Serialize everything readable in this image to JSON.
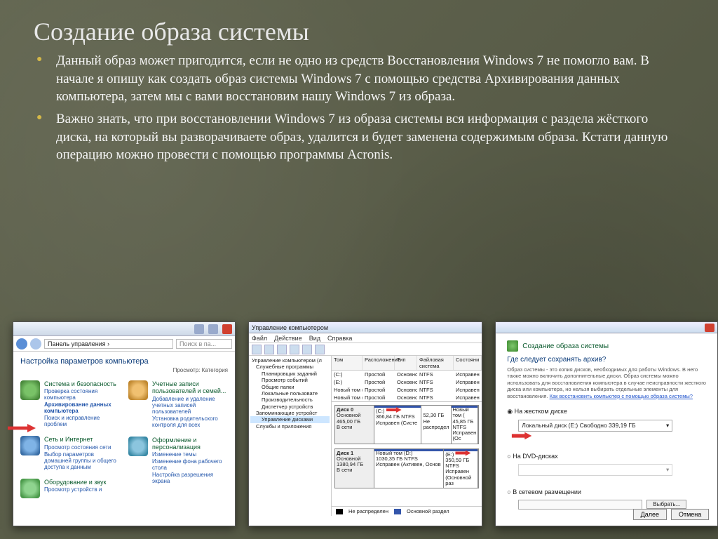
{
  "slide": {
    "title": "Создание образа системы",
    "bullet1": "Данный образ может пригодится, если не одно из средств Восстановления Windows 7 не помогло вам. В начале я опишу как создать образ системы Windows 7 с помощью средства Архивирования данных компьютера, затем мы с вами восстановим нашу Windows 7 из образа.",
    "bullet2": "Важно знать, что при восстановлении Windows 7 из образа системы вся информация с раздела жёсткого диска, на который вы разворачиваете образ, удалится и будет заменена содержимым образа. Кстати данную операцию можно провести с помощью программы Acronis."
  },
  "controlPanel": {
    "breadcrumb": "Панель управления ›",
    "searchPlaceholder": "Поиск в па...",
    "heading": "Настройка параметров компьютера",
    "view": "Просмотр:  Категория",
    "cat1": {
      "title": "Система и безопасность",
      "l1": "Проверка состояния компьютера",
      "l2": "Архивирование данных компьютера",
      "l3": "Поиск и исправление проблем"
    },
    "cat2": {
      "title": "Сеть и Интернет",
      "l1": "Просмотр состояния сети",
      "l2": "Выбор параметров домашней группы и общего доступа к данным"
    },
    "cat3": {
      "title": "Оборудование и звук",
      "l1": "Просмотр устройств и"
    },
    "cat4": {
      "title": "Учетные записи пользователей и семей...",
      "l1": "Добавление и удаление учетных записей пользователей",
      "l2": "Установка родительского контроля для всех"
    },
    "cat5": {
      "title": "Оформление и персонализация",
      "l1": "Изменение темы",
      "l2": "Изменение фона рабочего стола",
      "l3": "Настройка разрешения экрана"
    }
  },
  "compMgmt": {
    "title": "Управление компьютером",
    "menu": [
      "Файл",
      "Действие",
      "Вид",
      "Справка"
    ],
    "tree": [
      "Управление компьютером (л",
      "Служебные программы",
      "Планировщик заданий",
      "Просмотр событий",
      "Общие папки",
      "Локальные пользовате",
      "Производительность",
      "Диспетчер устройств",
      "Запоминающие устройст",
      "Управление дисками",
      "Службы и приложения"
    ],
    "cols": [
      "Том",
      "Расположение",
      "Тип",
      "Файловая система",
      "Состояни"
    ],
    "rows": [
      [
        "(C:)",
        "Простой",
        "Основной",
        "NTFS",
        "Исправен"
      ],
      [
        "(E:)",
        "Простой",
        "Основной",
        "NTFS",
        "Исправен"
      ],
      [
        "Новый том (J:)",
        "Простой",
        "Основной",
        "NTFS",
        "Исправен"
      ],
      [
        "Новый том (I:)",
        "Простой",
        "Основной",
        "NTFS",
        "Исправен"
      ]
    ],
    "disk0": {
      "name": "Диск 0",
      "type": "Основной",
      "size": "465,00 ГБ",
      "status": "В сети",
      "p1": {
        "label": "(C:)",
        "size": "366,84 ГБ NTFS",
        "status": "Исправен (Систе"
      },
      "p2": {
        "label": "",
        "size": "52,30 ГБ",
        "status": "Не распредел"
      },
      "p3": {
        "label": "Новый том (",
        "size": "45,85 ГБ NTFS",
        "status": "Исправен (Ос"
      }
    },
    "disk1": {
      "name": "Диск 1",
      "type": "Основной",
      "size": "1380,94 ГБ",
      "status": "В сети",
      "p1": {
        "label": "Новый том (D:)",
        "size": "1030,35 ГБ NTFS",
        "status": "Исправен (Активен, Основ"
      },
      "p2": {
        "label": "(E:)",
        "size": "350,59 ГБ NTFS",
        "status": "Исправен (Основной раз"
      }
    },
    "legend": {
      "unalloc": "Не распределен",
      "primary": "Основной раздел"
    }
  },
  "wizard": {
    "title": "Создание образа системы",
    "question": "Где следует сохранять архив?",
    "desc": "Образ системы - это копия дисков, необходимых для работы Windows. В него также можно включить дополнительные диски. Образ системы можно использовать для восстановления компьютера в случае неисправности жесткого диска или компьютера, но нельзя выбирать отдельные элементы для восстановления. ",
    "descLink": "Как восстановить компьютер с помощью образа системы?",
    "opt1": "На жестком диске",
    "drive": "Локальный диск (E:)  Свободно 339,19 ГБ",
    "opt2": "На DVD-дисках",
    "opt3": "В сетевом размещении",
    "browse": "Выбрать...",
    "next": "Далее",
    "cancel": "Отмена"
  }
}
